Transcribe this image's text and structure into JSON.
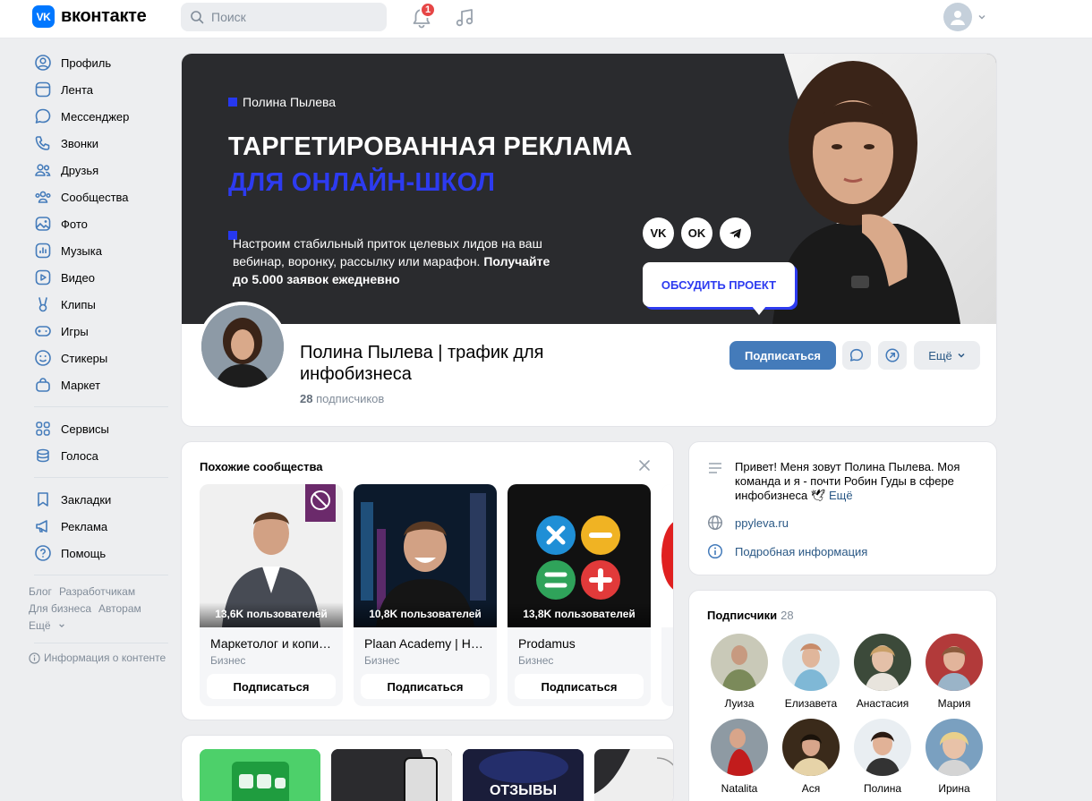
{
  "header": {
    "logo_text": "вконтакте",
    "logo_mark": "VK",
    "search_placeholder": "Поиск",
    "notifications_badge": "1"
  },
  "sidebar": {
    "items": [
      {
        "label": "Профиль",
        "icon": "user-circle-icon"
      },
      {
        "label": "Лента",
        "icon": "newsfeed-icon"
      },
      {
        "label": "Мессенджер",
        "icon": "message-icon"
      },
      {
        "label": "Звонки",
        "icon": "phone-icon"
      },
      {
        "label": "Друзья",
        "icon": "friends-icon"
      },
      {
        "label": "Сообщества",
        "icon": "communities-icon"
      },
      {
        "label": "Фото",
        "icon": "photo-icon"
      },
      {
        "label": "Музыка",
        "icon": "music-icon"
      },
      {
        "label": "Видео",
        "icon": "video-icon"
      },
      {
        "label": "Клипы",
        "icon": "clips-icon"
      },
      {
        "label": "Игры",
        "icon": "gamepad-icon"
      },
      {
        "label": "Стикеры",
        "icon": "smile-icon"
      },
      {
        "label": "Маркет",
        "icon": "market-bag-icon"
      }
    ],
    "items2": [
      {
        "label": "Сервисы",
        "icon": "services-grid-icon"
      },
      {
        "label": "Голоса",
        "icon": "coins-icon"
      }
    ],
    "items3": [
      {
        "label": "Закладки",
        "icon": "bookmark-icon"
      },
      {
        "label": "Реклама",
        "icon": "megaphone-icon"
      },
      {
        "label": "Помощь",
        "icon": "help-icon"
      }
    ],
    "footer": {
      "blog": "Блог",
      "developers": "Разработчикам",
      "business": "Для бизнеса",
      "authors": "Авторам",
      "more": "Ещё",
      "content_info": "Информация о контенте"
    }
  },
  "cover": {
    "author": "Полина Пылева",
    "title_line1": "ТАРГЕТИРОВАННАЯ РЕКЛАМА",
    "title_line2": "ДЛЯ ОНЛАЙН-ШКОЛ",
    "desc_line1": "Настроим стабильный приток целевых лидов на ваш",
    "desc_line2a": "вебинар, воронку, рассылку или марафон. ",
    "desc_line2b": "Получайте",
    "desc_line3": "до 5.000 заявок ежедневно",
    "social_vk": "VK",
    "social_ok": "OK",
    "cta": "ОБСУДИТЬ ПРОЕКТ"
  },
  "profile": {
    "name": "Полина Пылева | трафик для инфобизнеса",
    "subscribers_count": "28",
    "subscribers_label": "подписчиков",
    "subscribe_button": "Подписаться",
    "more_button": "Ещё"
  },
  "similar": {
    "title": "Похожие сообщества",
    "items": [
      {
        "name": "Маркетолог и копирайтер",
        "category": "Бизнес",
        "count": "13,6K пользователей",
        "button": "Подписаться"
      },
      {
        "name": "Plaan Academy | HEAD",
        "category": "Бизнес",
        "count": "10,8K пользователей",
        "button": "Подписаться"
      },
      {
        "name": "Prodamus",
        "category": "Бизнес",
        "count": "13,8K пользователей",
        "button": "Подписаться"
      }
    ]
  },
  "gallery": {
    "reviews_label": "ОТЗЫВЫ"
  },
  "info": {
    "about": "Привет! Меня зовут Полина Пылева. Моя команда и я - почти Робин Гуды в сфере инфобизнеса",
    "about_more": "Ещё",
    "site": "ppyleva.ru",
    "details": "Подробная информация"
  },
  "subscribers": {
    "title": "Подписчики",
    "count": "28",
    "people": [
      "Луиза",
      "Елизавета",
      "Анастасия",
      "Мария",
      "Natalita",
      "Ася",
      "Полина",
      "Ирина"
    ]
  },
  "colors": {
    "accent": "#447bba",
    "vk_blue": "#0077ff",
    "cover_blue": "#2d3bf0",
    "badge_red": "#e64646"
  }
}
